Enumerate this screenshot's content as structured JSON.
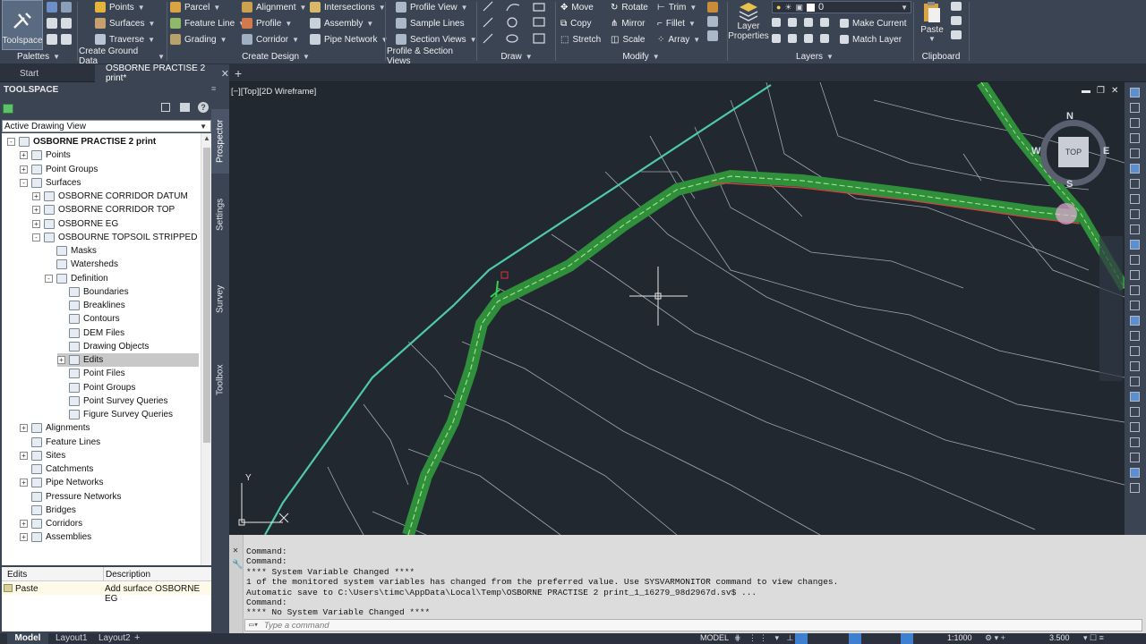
{
  "ribbon": {
    "toolspace": "Toolspace",
    "palettes": "Palettes",
    "ground": {
      "items": [
        "Points",
        "Surfaces",
        "Traverse"
      ],
      "panel": "Create Ground Data"
    },
    "design": {
      "col1": [
        "Parcel",
        "Feature Line",
        "Grading"
      ],
      "col2": [
        "Alignment",
        "Profile",
        "Corridor"
      ],
      "col3": [
        "Intersections",
        "Assembly",
        "Pipe Network"
      ],
      "panel": "Create Design"
    },
    "profile_section": {
      "items": [
        "Profile View",
        "Sample Lines",
        "Section Views"
      ],
      "panel": "Profile & Section Views"
    },
    "draw": {
      "panel": "Draw"
    },
    "modify": {
      "col1": [
        "Move",
        "Copy",
        "Stretch"
      ],
      "col2": [
        "Rotate",
        "Mirror",
        "Scale"
      ],
      "col3": [
        "Trim",
        "Fillet",
        "Array"
      ],
      "panel": "Modify"
    },
    "layers": {
      "layer_properties": "Layer Properties",
      "current_layer": "0",
      "make_current": "Make Current",
      "match_layer": "Match Layer",
      "panel": "Layers"
    },
    "clipboard": {
      "paste": "Paste",
      "panel": "Clipboard"
    }
  },
  "tabs": {
    "start": "Start",
    "active": "OSBORNE PRACTISE 2 print*"
  },
  "toolspace": {
    "title": "TOOLSPACE",
    "view": "Active Drawing View",
    "vertical_tabs": [
      "Prospector",
      "Settings",
      "Survey",
      "Toolbox"
    ],
    "tree": [
      {
        "label": "OSBORNE PRACTISE 2 print",
        "bold": true
      },
      {
        "label": "Points"
      },
      {
        "label": "Point Groups"
      },
      {
        "label": "Surfaces"
      },
      {
        "label": "OSBORNE CORRIDOR DATUM"
      },
      {
        "label": "OSBORNE CORRIDOR TOP"
      },
      {
        "label": "OSBORNE EG"
      },
      {
        "label": "OSBOURNE TOPSOIL STRIPPED"
      },
      {
        "label": "Masks"
      },
      {
        "label": "Watersheds"
      },
      {
        "label": "Definition"
      },
      {
        "label": "Boundaries"
      },
      {
        "label": "Breaklines"
      },
      {
        "label": "Contours"
      },
      {
        "label": "DEM Files"
      },
      {
        "label": "Drawing Objects"
      },
      {
        "label": "Edits"
      },
      {
        "label": "Point Files"
      },
      {
        "label": "Point Groups"
      },
      {
        "label": "Point Survey Queries"
      },
      {
        "label": "Figure Survey Queries"
      },
      {
        "label": "Alignments"
      },
      {
        "label": "Feature Lines"
      },
      {
        "label": "Sites"
      },
      {
        "label": "Catchments"
      },
      {
        "label": "Pipe Networks"
      },
      {
        "label": "Pressure Networks"
      },
      {
        "label": "Bridges"
      },
      {
        "label": "Corridors"
      },
      {
        "label": "Assemblies"
      }
    ],
    "list": {
      "headers": [
        "Edits",
        "Description"
      ],
      "rows": [
        {
          "edit": "Paste",
          "description": "Add surface OSBORNE EG"
        }
      ]
    }
  },
  "viewport": {
    "label": "[−][Top][2D Wireframe]",
    "viewcube": {
      "top": "TOP",
      "n": "N",
      "s": "S",
      "e": "E",
      "w": "W"
    },
    "ucs_y": "Y"
  },
  "command": {
    "lines": [
      "Command:",
      "Command:",
      "**** System Variable Changed ****",
      "1 of the monitored system variables has changed from the preferred value. Use SYSVARMONITOR command to view changes.",
      "Automatic save to C:\\Users\\timc\\AppData\\Local\\Temp\\OSBORNE PRACTISE 2 print_1_16279_98d2967d.sv$ ...",
      "Command:",
      "**** No System Variable Changed ****"
    ],
    "placeholder": "Type a command"
  },
  "status": {
    "layout_tabs": [
      "Model",
      "Layout1",
      "Layout2"
    ],
    "model": "MODEL",
    "scale": "1:1000",
    "value": "3.500"
  }
}
